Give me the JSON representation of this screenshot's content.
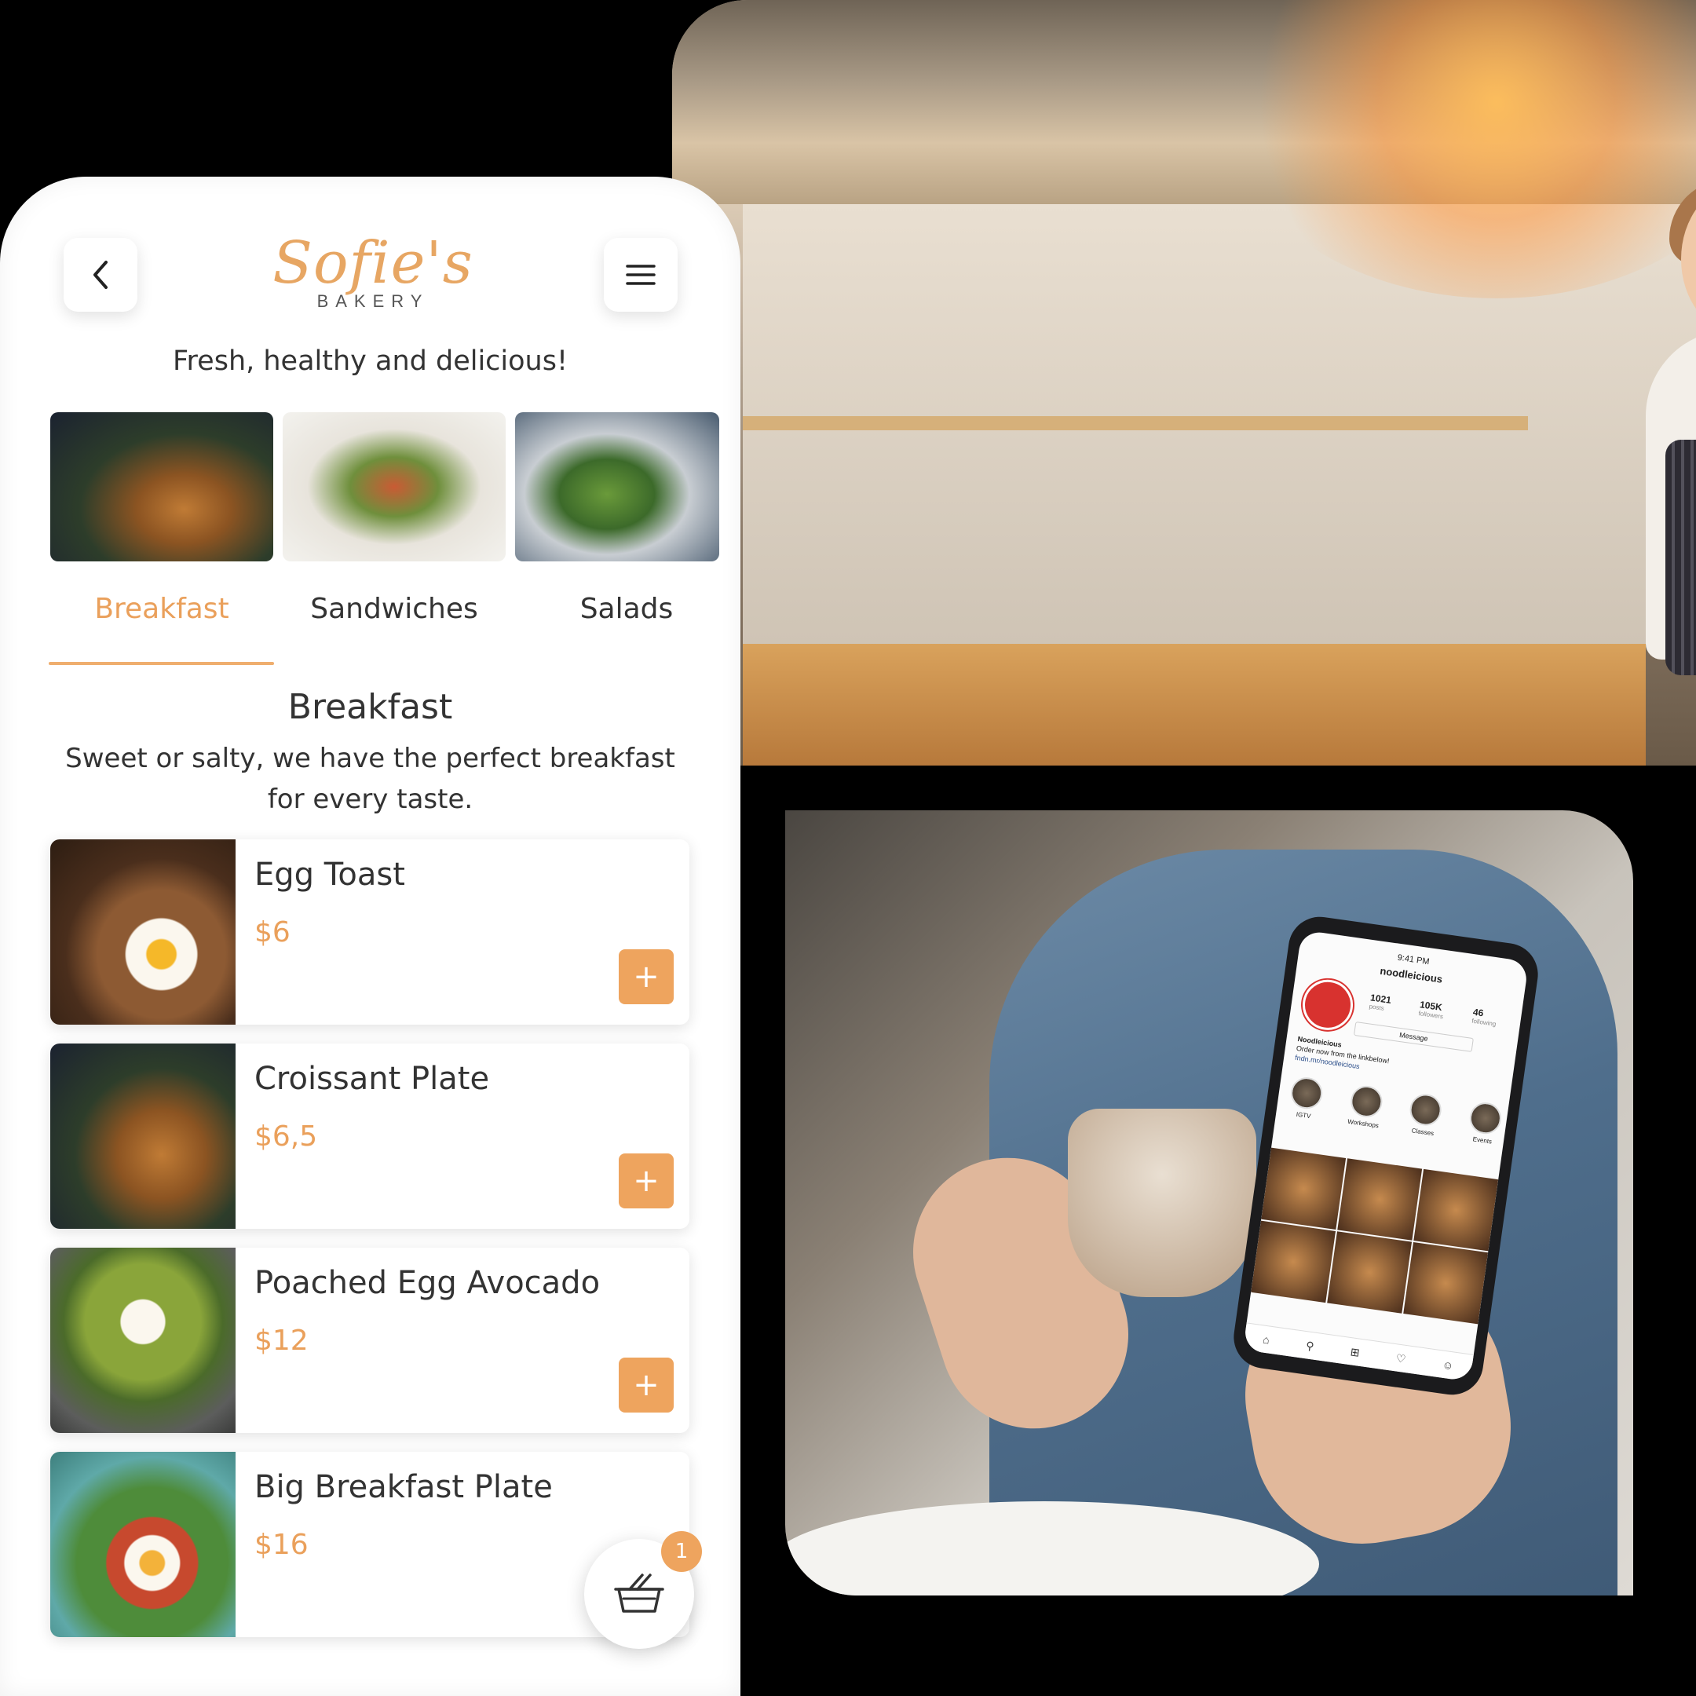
{
  "app": {
    "logo": {
      "script": "Sofie's",
      "sub": "BAKERY"
    },
    "tagline": "Fresh, healthy and delicious!",
    "accent_color": "#EEA45E",
    "categories": [
      {
        "label": "Breakfast",
        "active": true
      },
      {
        "label": "Sandwiches",
        "active": false
      },
      {
        "label": "Salads",
        "active": false
      }
    ],
    "section": {
      "title": "Breakfast",
      "description": "Sweet or salty, we have the perfect breakfast for every taste."
    },
    "items": [
      {
        "name": "Egg Toast",
        "price": "$6"
      },
      {
        "name": "Croissant Plate",
        "price": "$6,5"
      },
      {
        "name": "Poached Egg Avocado",
        "price": "$12"
      },
      {
        "name": "Big Breakfast Plate",
        "price": "$16"
      }
    ],
    "add_label": "+",
    "cart_count": "1"
  },
  "phone": {
    "time": "9:41 PM",
    "username": "noodleicious",
    "stats": [
      {
        "value": "1021",
        "label": "posts"
      },
      {
        "value": "105K",
        "label": "followers"
      },
      {
        "value": "46",
        "label": "following"
      }
    ],
    "message_button": "Message",
    "bio_name": "Noodleicious",
    "bio_text": "Order now from the linkbelow!",
    "bio_link": "fndn.mr/noodleicious",
    "highlights": [
      "IGTV",
      "Workshops",
      "Classes",
      "Events"
    ]
  }
}
